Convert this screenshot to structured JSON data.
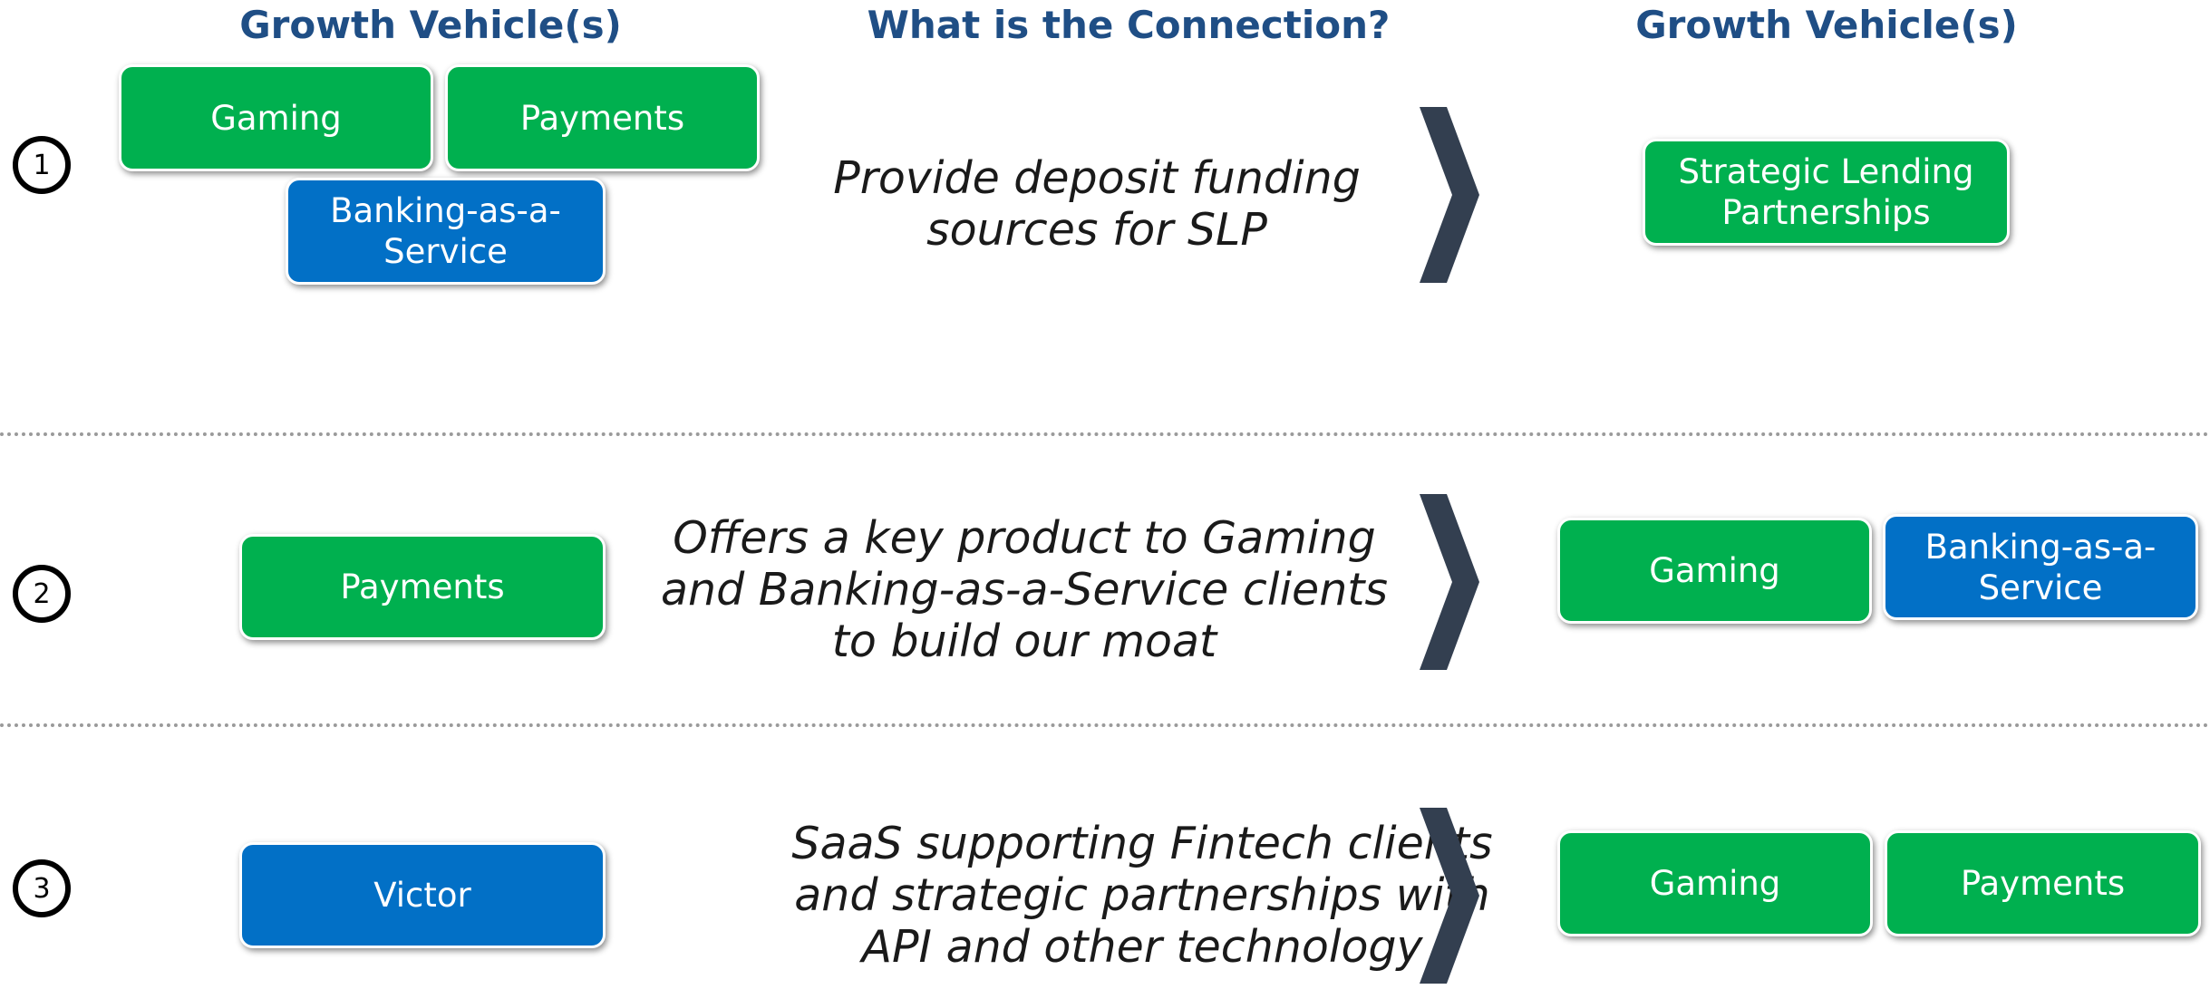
{
  "headers": {
    "left": "Growth Vehicle(s)",
    "middle": "What is the Connection?",
    "right": "Growth Vehicle(s)"
  },
  "colors": {
    "green": "#00B04F",
    "blue": "#0270C6",
    "header": "#1F4E85",
    "chevron": "#333F50"
  },
  "rows": [
    {
      "number": "1",
      "left": [
        {
          "label": "Gaming",
          "color": "green"
        },
        {
          "label": "Payments",
          "color": "green"
        },
        {
          "label": "Banking-as-a-Service",
          "color": "blue"
        }
      ],
      "connection": "Provide deposit funding sources for SLP",
      "right": [
        {
          "label": "Strategic Lending Partnerships",
          "color": "green"
        }
      ]
    },
    {
      "number": "2",
      "left": [
        {
          "label": "Payments",
          "color": "green"
        }
      ],
      "connection": "Offers a key product to Gaming and Banking-as-a-Service clients to build our moat",
      "right": [
        {
          "label": "Gaming",
          "color": "green"
        },
        {
          "label": "Banking-as-a-Service",
          "color": "blue"
        }
      ]
    },
    {
      "number": "3",
      "left": [
        {
          "label": "Victor",
          "color": "blue"
        }
      ],
      "connection": "SaaS supporting Fintech clients and strategic partnerships with API and other technology",
      "right": [
        {
          "label": "Gaming",
          "color": "green"
        },
        {
          "label": "Payments",
          "color": "green"
        }
      ]
    }
  ]
}
